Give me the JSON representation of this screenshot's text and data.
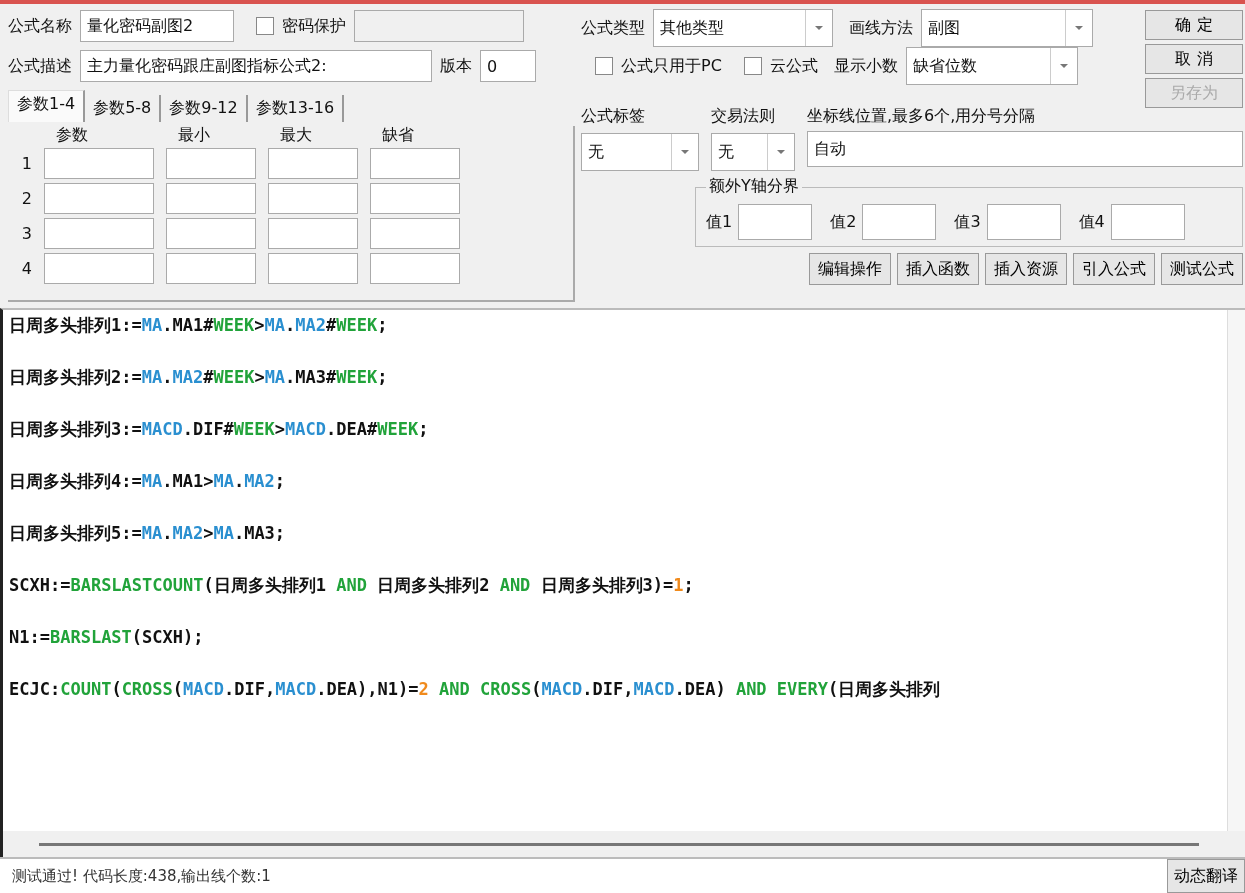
{
  "name": {
    "label": "公式名称",
    "value": "量化密码副图2"
  },
  "password": {
    "label": "密码保护",
    "checked": false
  },
  "description": {
    "label": "公式描述",
    "value": "主力量化密码跟庄副图指标公式2:"
  },
  "version": {
    "label": "版本",
    "value": "0"
  },
  "param_tabs": [
    {
      "label": "参数1-4",
      "selected": true
    },
    {
      "label": "参数5-8",
      "selected": false
    },
    {
      "label": "参数9-12",
      "selected": false
    },
    {
      "label": "参数13-16",
      "selected": false
    }
  ],
  "param_table": {
    "columns": [
      "参数",
      "最小",
      "最大",
      "缺省"
    ],
    "rows": [
      "1",
      "2",
      "3",
      "4"
    ]
  },
  "formula_type": {
    "label": "公式类型",
    "value": "其他类型"
  },
  "draw_method": {
    "label": "画线方法",
    "value": "副图"
  },
  "pc_only": {
    "label": "公式只用于PC",
    "checked": false
  },
  "cloud": {
    "label": "云公式",
    "checked": false
  },
  "decimals": {
    "label": "显示小数",
    "value": "缺省位数"
  },
  "dialog_buttons": [
    {
      "label": "确 定",
      "disabled": false
    },
    {
      "label": "取 消",
      "disabled": false
    },
    {
      "label": "另存为",
      "disabled": true
    }
  ],
  "formula_tag": {
    "label": "公式标签",
    "value": "无"
  },
  "trade_rule": {
    "label": "交易法则",
    "value": "无"
  },
  "axis_lines": {
    "label": "坐标线位置,最多6个,用分号分隔",
    "value": "自动"
  },
  "y_axis": {
    "title": "额外Y轴分界",
    "fields": [
      "值1",
      "值2",
      "值3",
      "值4"
    ]
  },
  "tool_buttons": [
    "编辑操作",
    "插入函数",
    "插入资源",
    "引入公式",
    "测试公式"
  ],
  "code": {
    "lines": [
      [
        {
          "text": "日周多头排列1:=",
          "kind": "text"
        },
        {
          "text": "MA",
          "kind": "ref"
        },
        {
          "text": ".MA1#",
          "kind": "text"
        },
        {
          "text": "WEEK",
          "kind": "func"
        },
        {
          "text": ">",
          "kind": "text"
        },
        {
          "text": "MA",
          "kind": "ref"
        },
        {
          "text": ".",
          "kind": "text"
        },
        {
          "text": "MA2",
          "kind": "ref"
        },
        {
          "text": "#",
          "kind": "text"
        },
        {
          "text": "WEEK",
          "kind": "func"
        },
        {
          "text": ";",
          "kind": "text"
        }
      ],
      [
        {
          "text": "日周多头排列2:=",
          "kind": "text"
        },
        {
          "text": "MA",
          "kind": "ref"
        },
        {
          "text": ".",
          "kind": "text"
        },
        {
          "text": "MA2",
          "kind": "ref"
        },
        {
          "text": "#",
          "kind": "text"
        },
        {
          "text": "WEEK",
          "kind": "func"
        },
        {
          "text": ">",
          "kind": "text"
        },
        {
          "text": "MA",
          "kind": "ref"
        },
        {
          "text": ".MA3#",
          "kind": "text"
        },
        {
          "text": "WEEK",
          "kind": "func"
        },
        {
          "text": ";",
          "kind": "text"
        }
      ],
      [
        {
          "text": "日周多头排列3:=",
          "kind": "text"
        },
        {
          "text": "MACD",
          "kind": "ref"
        },
        {
          "text": ".DIF#",
          "kind": "text"
        },
        {
          "text": "WEEK",
          "kind": "func"
        },
        {
          "text": ">",
          "kind": "text"
        },
        {
          "text": "MACD",
          "kind": "ref"
        },
        {
          "text": ".DEA#",
          "kind": "text"
        },
        {
          "text": "WEEK",
          "kind": "func"
        },
        {
          "text": ";",
          "kind": "text"
        }
      ],
      [
        {
          "text": "日周多头排列4:=",
          "kind": "text"
        },
        {
          "text": "MA",
          "kind": "ref"
        },
        {
          "text": ".MA1>",
          "kind": "text"
        },
        {
          "text": "MA",
          "kind": "ref"
        },
        {
          "text": ".",
          "kind": "text"
        },
        {
          "text": "MA2",
          "kind": "ref"
        },
        {
          "text": ";",
          "kind": "text"
        }
      ],
      [
        {
          "text": "日周多头排列5:=",
          "kind": "text"
        },
        {
          "text": "MA",
          "kind": "ref"
        },
        {
          "text": ".",
          "kind": "text"
        },
        {
          "text": "MA2",
          "kind": "ref"
        },
        {
          "text": ">",
          "kind": "text"
        },
        {
          "text": "MA",
          "kind": "ref"
        },
        {
          "text": ".MA3;",
          "kind": "text"
        }
      ],
      [
        {
          "text": "SCXH:=",
          "kind": "text"
        },
        {
          "text": "BARSLASTCOUNT",
          "kind": "func"
        },
        {
          "text": "(日周多头排列1 ",
          "kind": "text"
        },
        {
          "text": "AND",
          "kind": "func"
        },
        {
          "text": " 日周多头排列2 ",
          "kind": "text"
        },
        {
          "text": "AND",
          "kind": "func"
        },
        {
          "text": " 日周多头排列3)=",
          "kind": "text"
        },
        {
          "text": "1",
          "kind": "number"
        },
        {
          "text": ";",
          "kind": "text"
        }
      ],
      [
        {
          "text": "N1:=",
          "kind": "text"
        },
        {
          "text": "BARSLAST",
          "kind": "func"
        },
        {
          "text": "(SCXH);",
          "kind": "text"
        }
      ],
      [
        {
          "text": "ECJC:",
          "kind": "text"
        },
        {
          "text": "COUNT",
          "kind": "func"
        },
        {
          "text": "(",
          "kind": "text"
        },
        {
          "text": "CROSS",
          "kind": "func"
        },
        {
          "text": "(",
          "kind": "text"
        },
        {
          "text": "MACD",
          "kind": "ref"
        },
        {
          "text": ".DIF,",
          "kind": "text"
        },
        {
          "text": "MACD",
          "kind": "ref"
        },
        {
          "text": ".DEA),N1)=",
          "kind": "text"
        },
        {
          "text": "2",
          "kind": "number"
        },
        {
          "text": " AND CROSS",
          "kind": "func"
        },
        {
          "text": "(",
          "kind": "text"
        },
        {
          "text": "MACD",
          "kind": "ref"
        },
        {
          "text": ".DIF,",
          "kind": "text"
        },
        {
          "text": "MACD",
          "kind": "ref"
        },
        {
          "text": ".DEA) ",
          "kind": "text"
        },
        {
          "text": "AND EVERY",
          "kind": "func"
        },
        {
          "text": "(日周多头排列",
          "kind": "text"
        }
      ]
    ]
  },
  "status": "测试通过! 代码长度:438,输出线个数:1",
  "translate_button": "动态翻译"
}
